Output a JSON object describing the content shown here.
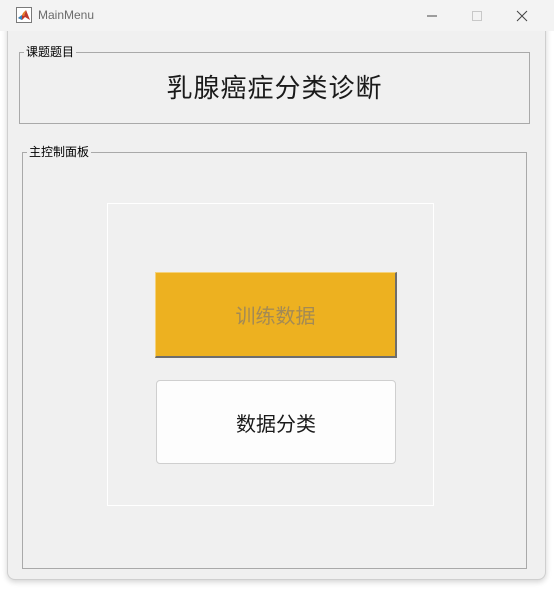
{
  "window": {
    "title": "MainMenu",
    "app_icon": "matlab-icon",
    "controls": {
      "minimize_icon": "minimize-icon",
      "maximize_icon": "maximize-icon",
      "close_icon": "close-icon"
    }
  },
  "topic_panel": {
    "legend": "课题题目",
    "title": "乳腺癌症分类诊断"
  },
  "control_panel": {
    "legend": "主控制面板",
    "buttons": [
      {
        "label": "训练数据",
        "color": "#edb120",
        "text_color": "#a38a55"
      },
      {
        "label": "数据分类",
        "color": "#fdfdfd",
        "text_color": "#1a1a1a"
      }
    ]
  }
}
